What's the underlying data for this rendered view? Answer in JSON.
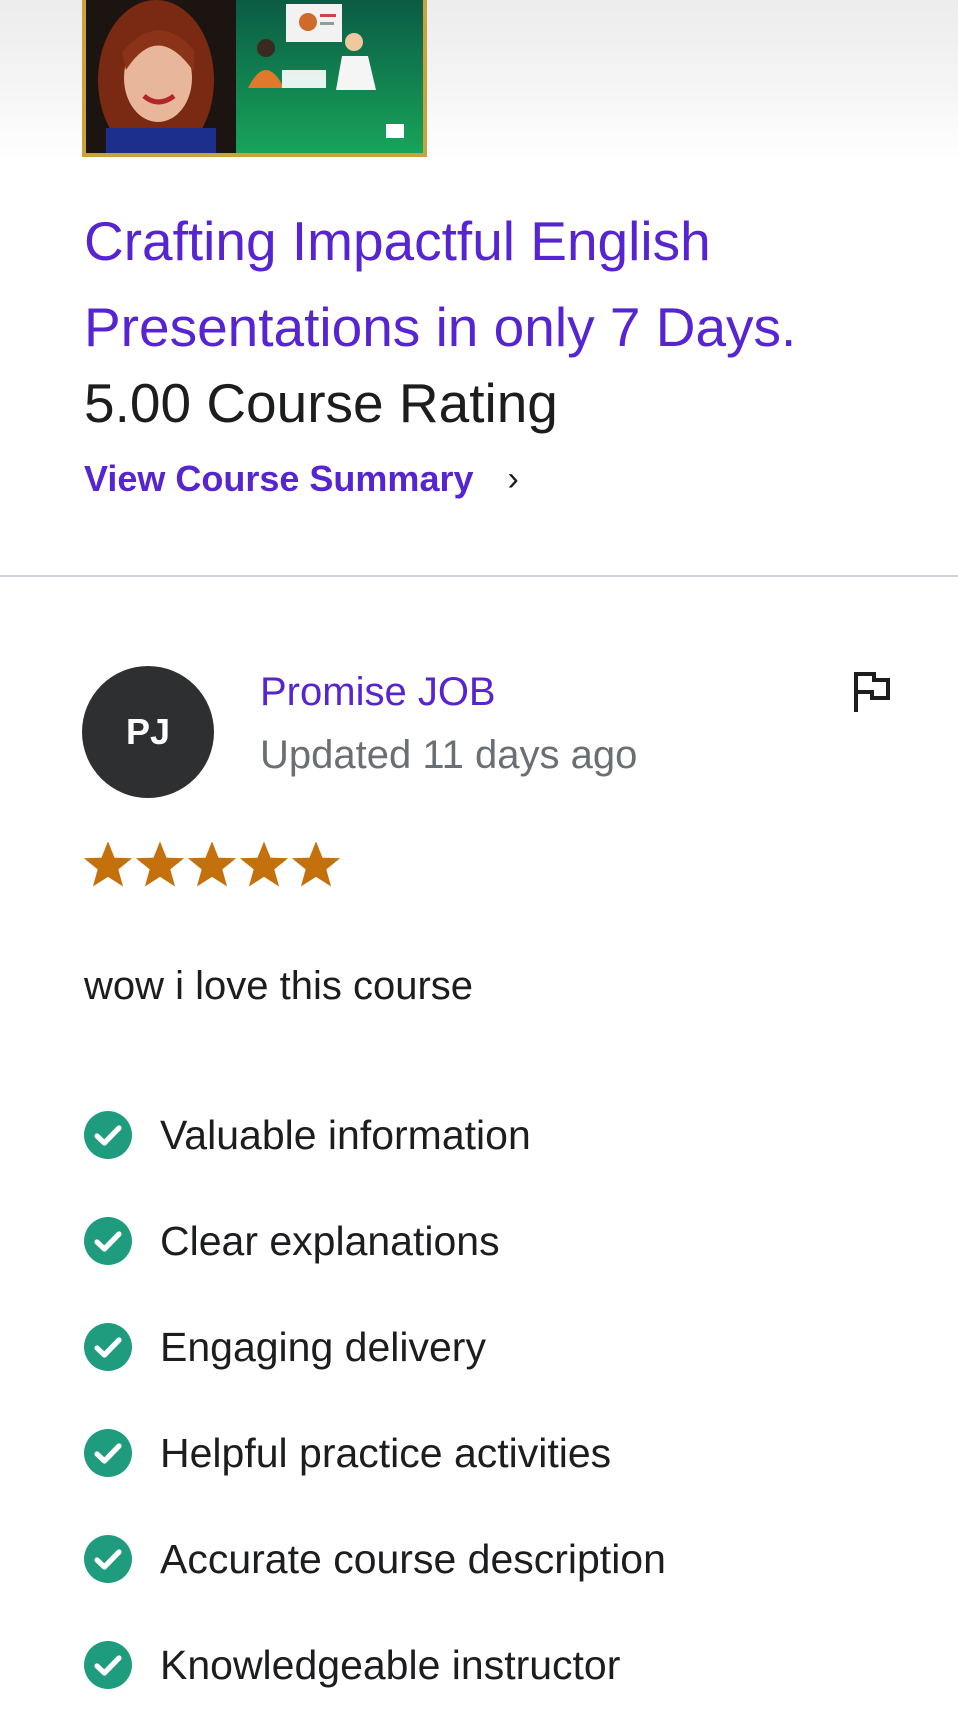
{
  "course": {
    "title": "Crafting Impactful English Presentations in only 7 Days.",
    "rating_text": "5.00 Course Rating",
    "summary_link": "View Course Summary",
    "summary_chevron": "›",
    "thumbnail_icon": "course-thumbnail-image"
  },
  "review": {
    "avatar_initials": "PJ",
    "reviewer_name": "Promise JOB",
    "updated": "Updated 11 days ago",
    "flag_icon": "flag-icon",
    "stars": 5,
    "max_stars": 5,
    "star_color": "#c4710d",
    "text": "wow i love this course",
    "tags": [
      "Valuable information",
      "Clear explanations",
      "Engaging delivery",
      "Helpful practice activities",
      "Accurate course description",
      "Knowledgeable instructor"
    ],
    "check_icon": "check-circle-icon",
    "check_color": "#1e9c7d"
  },
  "colors": {
    "link_purple": "#5624d0",
    "text_dark": "#1c1d1f",
    "muted_gray": "#6a6f73",
    "avatar_bg": "#2d2f31"
  }
}
